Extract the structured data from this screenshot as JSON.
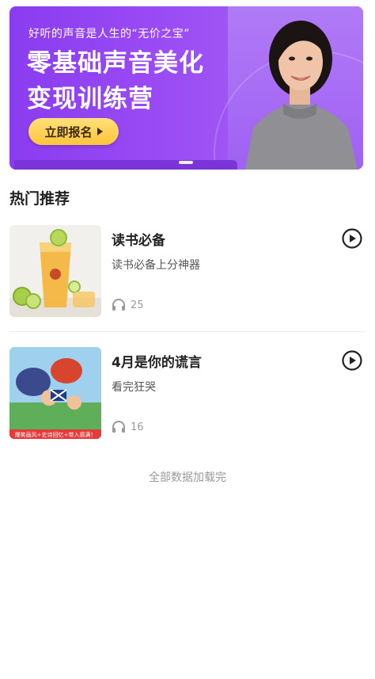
{
  "banner": {
    "tagline": "好听的声音是人生的“无价之宝”",
    "headline_line1": "零基础声音美化",
    "headline_line2": "变现训练营",
    "cta_label": "立即报名",
    "colors": {
      "start": "#8a3cf0",
      "end": "#a86af5",
      "cta": "#ffc53a"
    }
  },
  "section": {
    "title": "热门推荐"
  },
  "items": [
    {
      "title": "读书必备",
      "subtitle": "读书必备上分神器",
      "plays": "25",
      "thumbnail": "iced-tea-drink-image",
      "play_icon": "play-circle-icon",
      "listen_icon": "headphones-icon"
    },
    {
      "title": "4月是你的谎言",
      "subtitle": "看完狂哭",
      "plays": "16",
      "thumbnail": "cartoon-poster-image",
      "thumbnail_caption": "爆笑画风+史诗回忆+带入感满！",
      "play_icon": "play-circle-icon",
      "listen_icon": "headphones-icon"
    }
  ],
  "footer": {
    "message": "全部数据加载完"
  }
}
